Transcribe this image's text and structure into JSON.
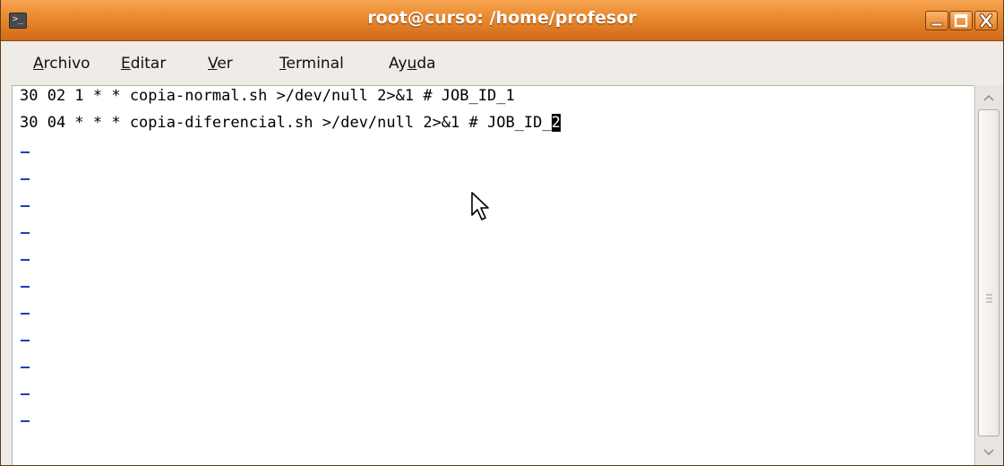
{
  "window": {
    "title": "root@curso: /home/profesor",
    "icon": "terminal-icon",
    "controls": [
      "minimize-icon",
      "maximize-icon",
      "close-icon"
    ],
    "accent_color": "#e8892d"
  },
  "menubar": {
    "items": [
      {
        "label": "Archivo",
        "mnemonic": "A"
      },
      {
        "label": "Editar",
        "mnemonic": "E"
      },
      {
        "label": "Ver",
        "mnemonic": "V"
      },
      {
        "label": "Terminal",
        "mnemonic": "T"
      },
      {
        "label": "Ayuda",
        "mnemonic": "u"
      }
    ]
  },
  "terminal": {
    "lines": [
      "30 02 1 * * copia-normal.sh >/dev/null 2>&1 # JOB_ID_1",
      "30 04 * * * copia-diferencial.sh >/dev/null 2>&1 # JOB_ID_"
    ],
    "cursor_char": "2",
    "empty_line_marker": "~",
    "empty_line_count": 11,
    "empty_line_color": "#1f3fb8"
  }
}
